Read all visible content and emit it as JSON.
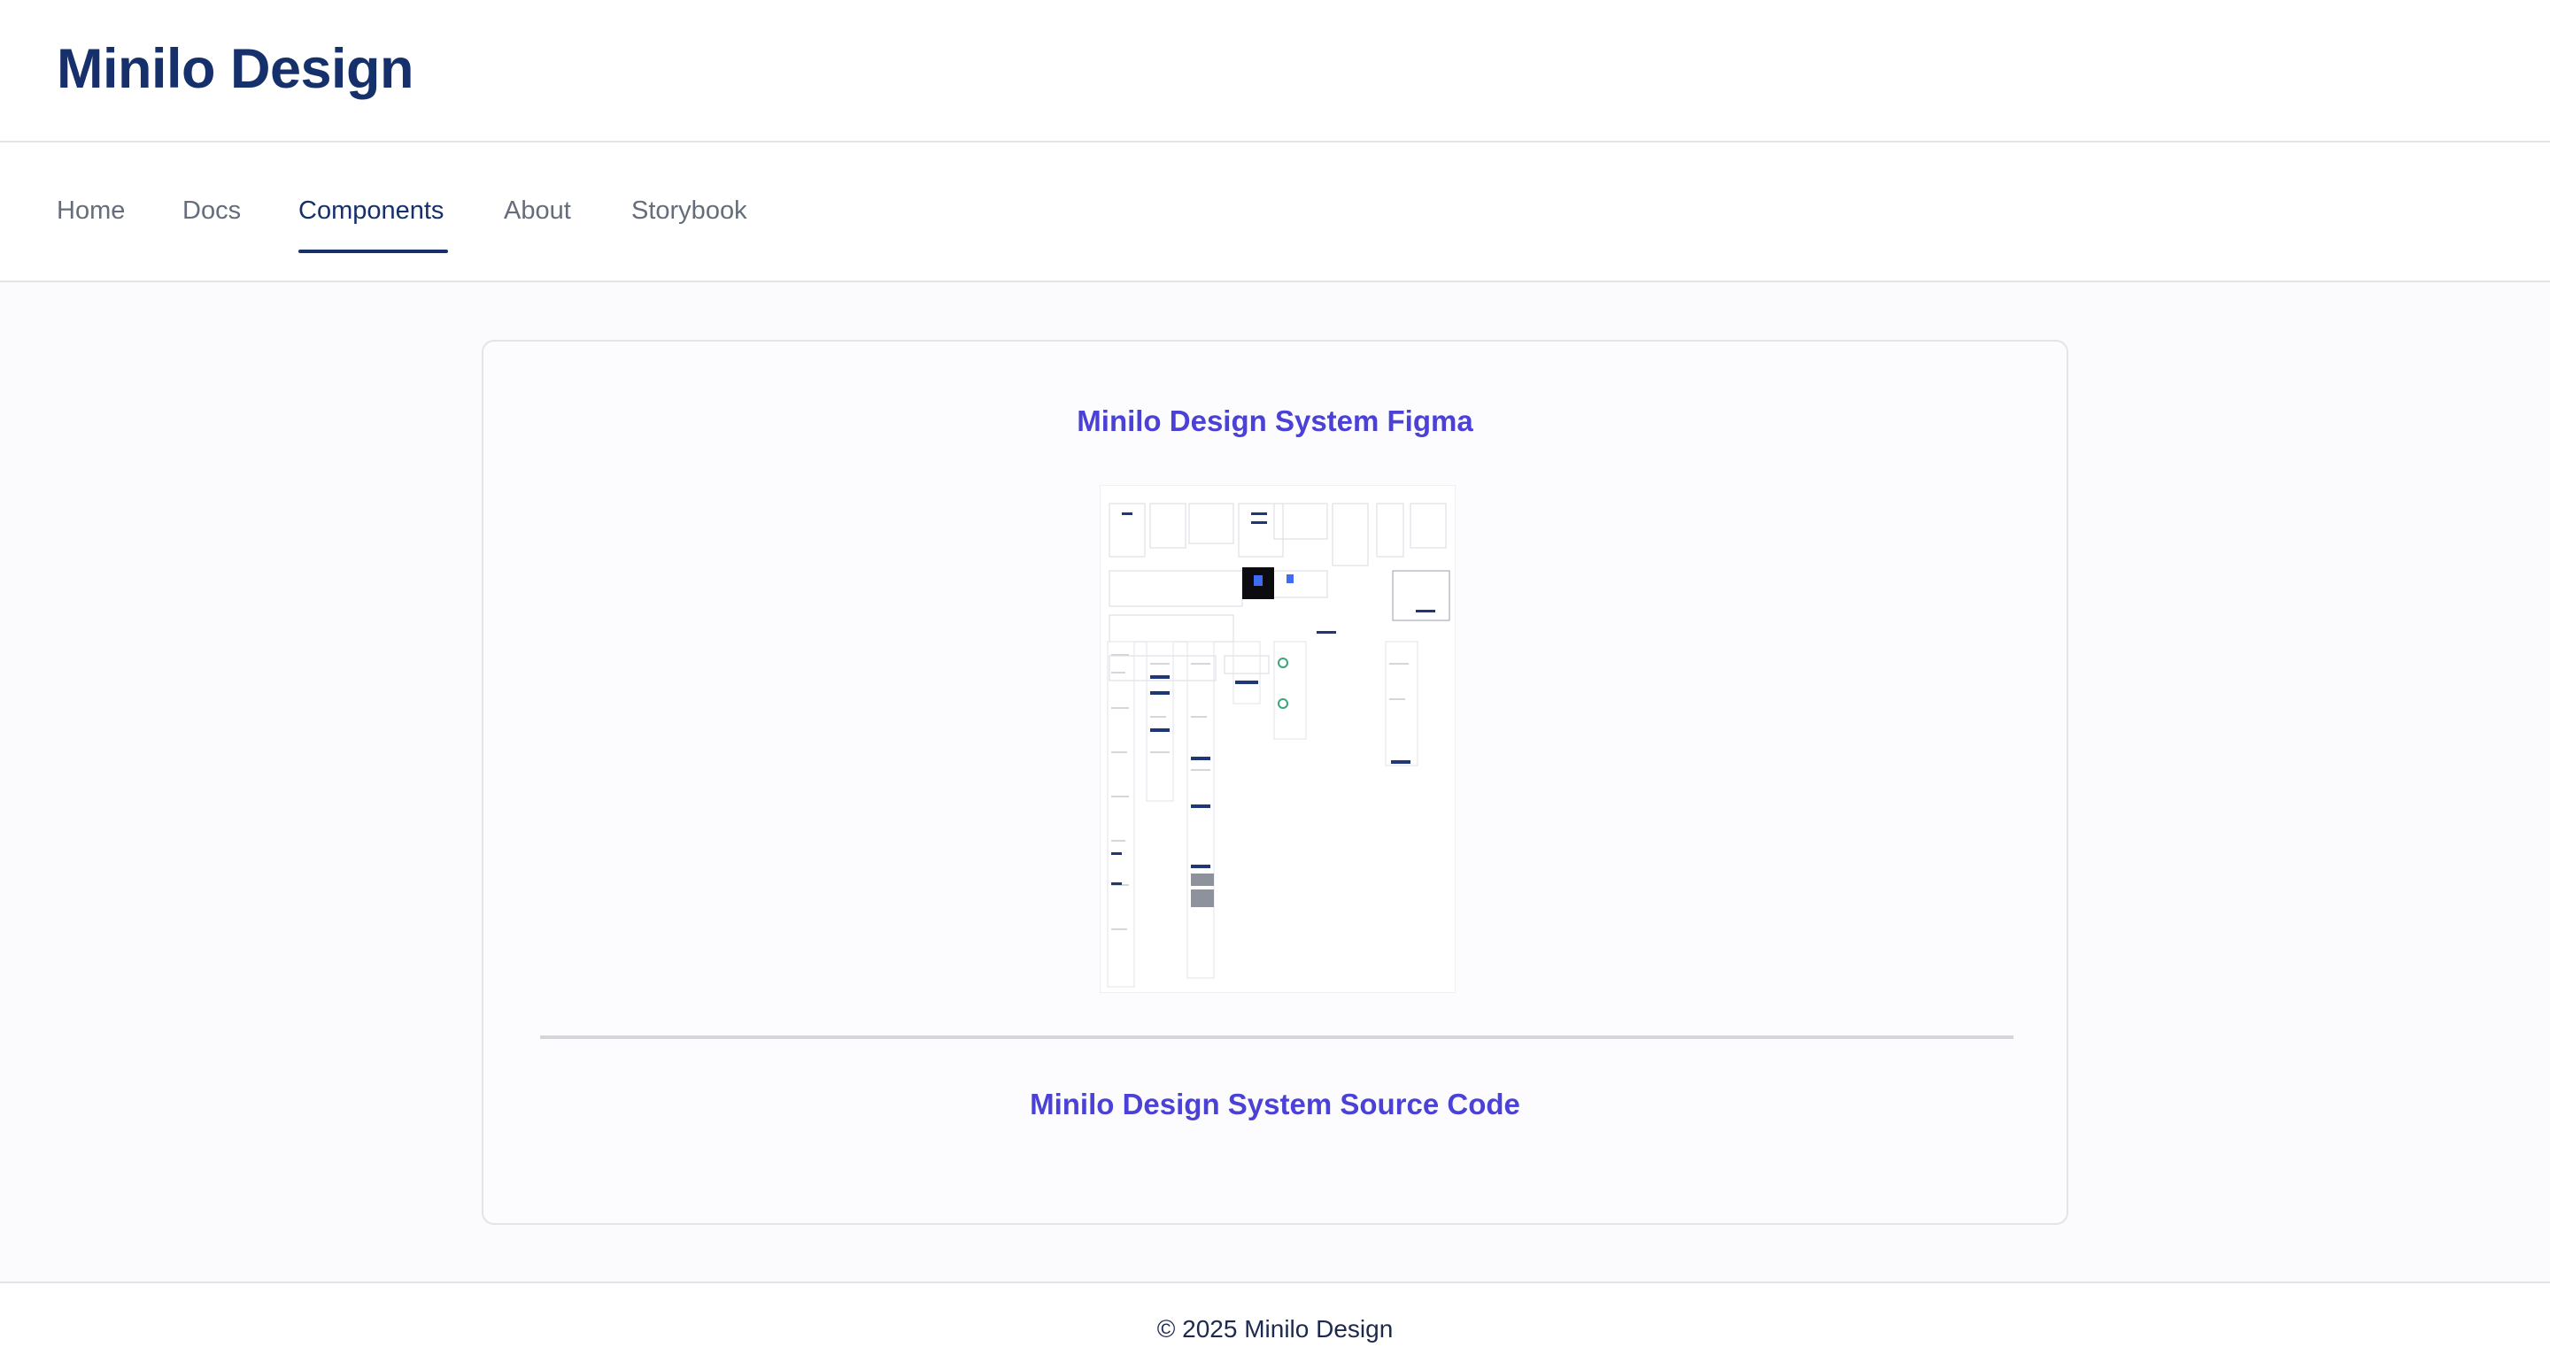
{
  "header": {
    "title": "Minilo Design"
  },
  "nav": {
    "items": [
      {
        "label": "Home"
      },
      {
        "label": "Docs"
      },
      {
        "label": "Components"
      },
      {
        "label": "About"
      },
      {
        "label": "Storybook"
      }
    ],
    "active": "Components"
  },
  "main": {
    "figma_link": "Minilo Design System Figma",
    "source_link": "Minilo Design System Source Code"
  },
  "footer": {
    "copyright": "© 2025 Minilo Design"
  },
  "colors": {
    "brand_navy": "#16306b",
    "link_indigo": "#4b41d6",
    "nav_gray": "#656c7a",
    "border": "#e3e4e8",
    "page_bg": "#fbfbfd"
  }
}
